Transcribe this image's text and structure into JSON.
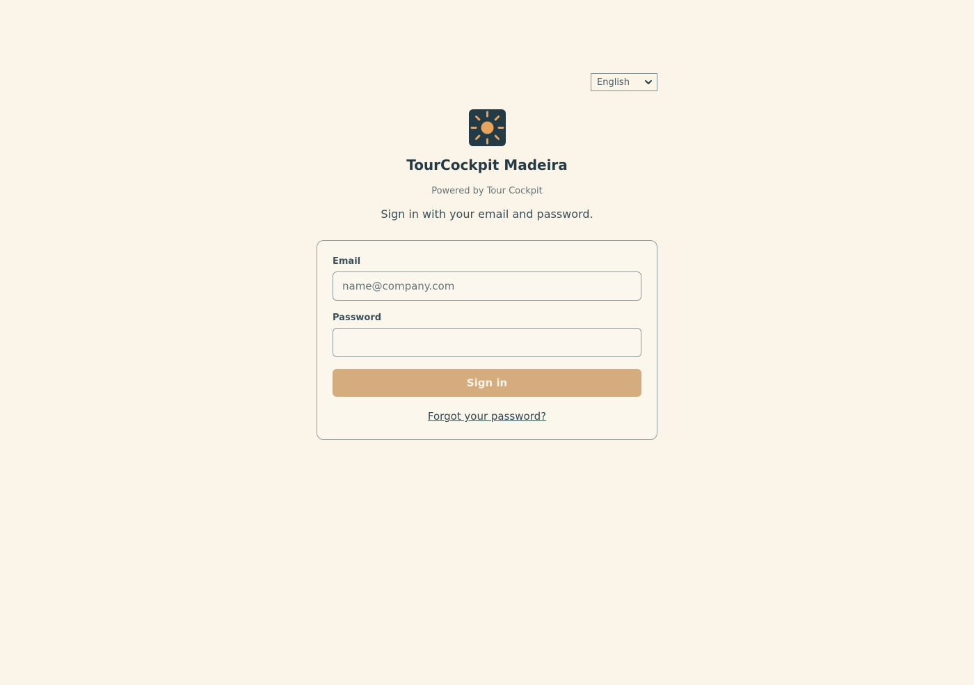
{
  "language": {
    "selected": "English",
    "icon": "chevron-down-icon"
  },
  "brand": {
    "logo_icon": "sun-icon",
    "title": "TourCockpit Madeira",
    "powered_by": "Powered by Tour Cockpit"
  },
  "intro": {
    "text": "Sign in with your email and password."
  },
  "form": {
    "email_label": "Email",
    "email_placeholder": "name@company.com",
    "email_value": "",
    "password_label": "Password",
    "password_value": "",
    "sign_in_label": "Sign in",
    "forgot_password_label": "Forgot your password?"
  },
  "colors": {
    "background": "#fbf4e8",
    "primary_dark": "#243b45",
    "accent": "#e6a45e",
    "button": "#d5ac7d"
  }
}
